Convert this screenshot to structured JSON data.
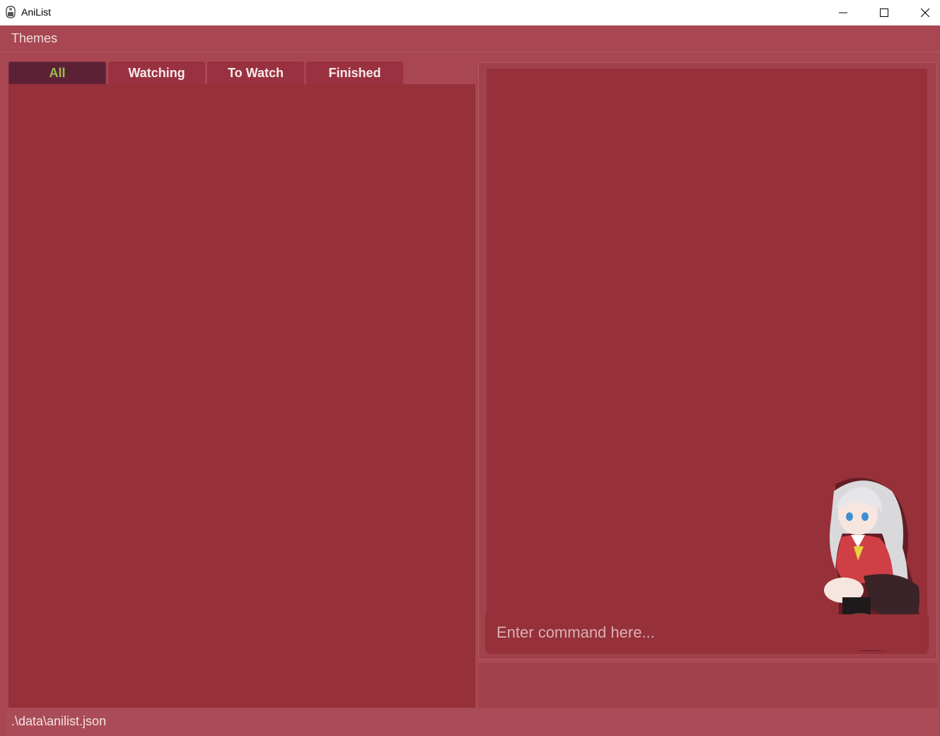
{
  "window": {
    "title": "AniList",
    "app_icon": "anilist-app-icon",
    "controls": [
      "minimize-icon",
      "maximize-icon",
      "close-icon"
    ]
  },
  "menubar": {
    "themes_label": "Themes"
  },
  "tabs": [
    {
      "label": "All",
      "active": true
    },
    {
      "label": "Watching",
      "active": false
    },
    {
      "label": "To Watch",
      "active": false
    },
    {
      "label": "Finished",
      "active": false
    }
  ],
  "command_box": {
    "placeholder": "Enter command here...",
    "value": ""
  },
  "status_bar": {
    "file_path": ".\\data\\anilist.json"
  },
  "colors": {
    "background": "#a84651",
    "panel": "#963039",
    "active_tab": "#5c2135",
    "active_tab_text": "#9bbd4e"
  }
}
